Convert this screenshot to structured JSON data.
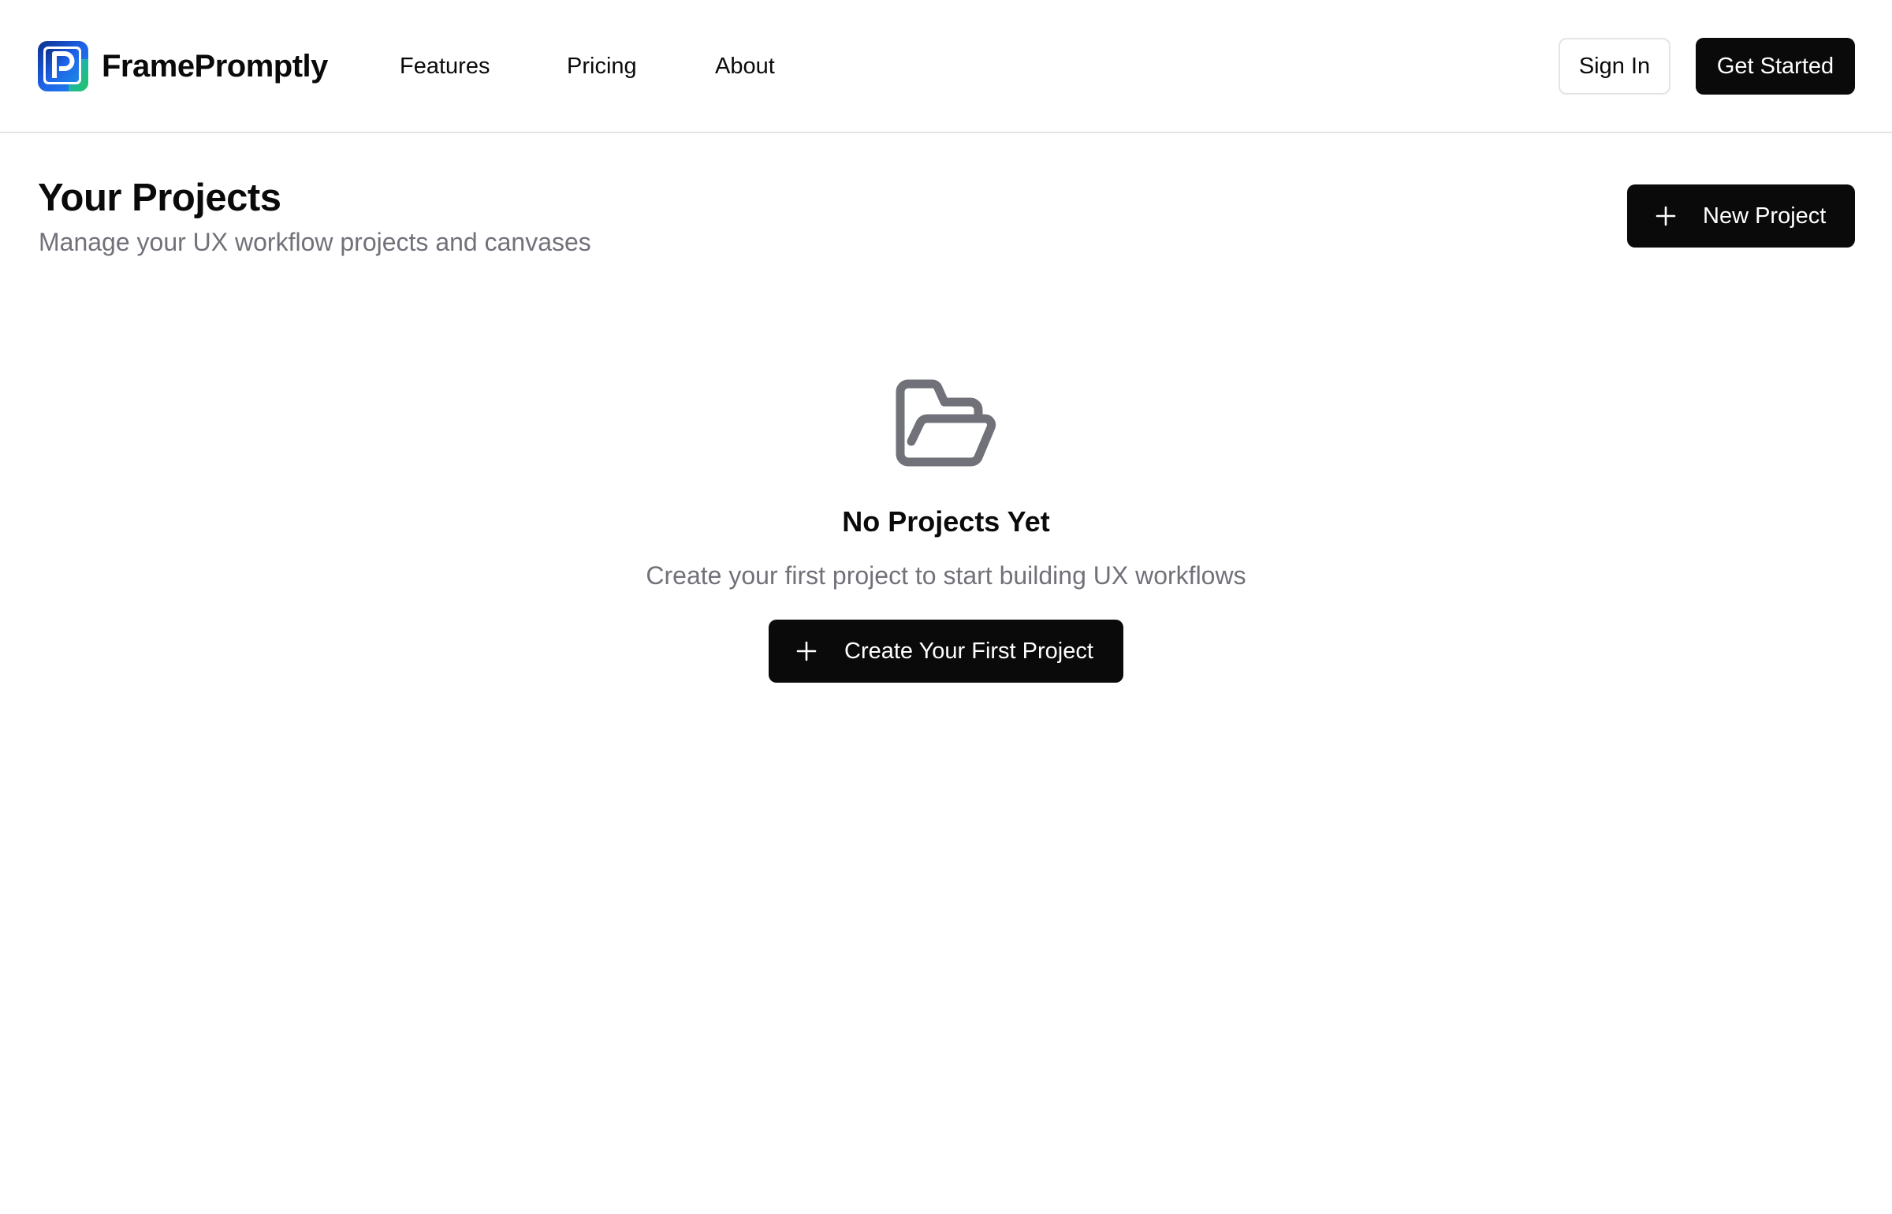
{
  "header": {
    "brand_name": "FramePromptly",
    "nav": [
      {
        "label": "Features"
      },
      {
        "label": "Pricing"
      },
      {
        "label": "About"
      }
    ],
    "sign_in_label": "Sign In",
    "get_started_label": "Get Started"
  },
  "page": {
    "title": "Your Projects",
    "subtitle": "Manage your UX workflow projects and canvases",
    "new_project_label": "New Project"
  },
  "empty_state": {
    "icon": "folder-open-icon",
    "title": "No Projects Yet",
    "description": "Create your first project to start building UX workflows",
    "cta_label": "Create Your First Project"
  },
  "colors": {
    "primary": "#0a0a0a",
    "muted_text": "#71717a",
    "border": "#e4e4e7",
    "logo_gradient": [
      "#1d4ed8",
      "#22c55e"
    ]
  }
}
